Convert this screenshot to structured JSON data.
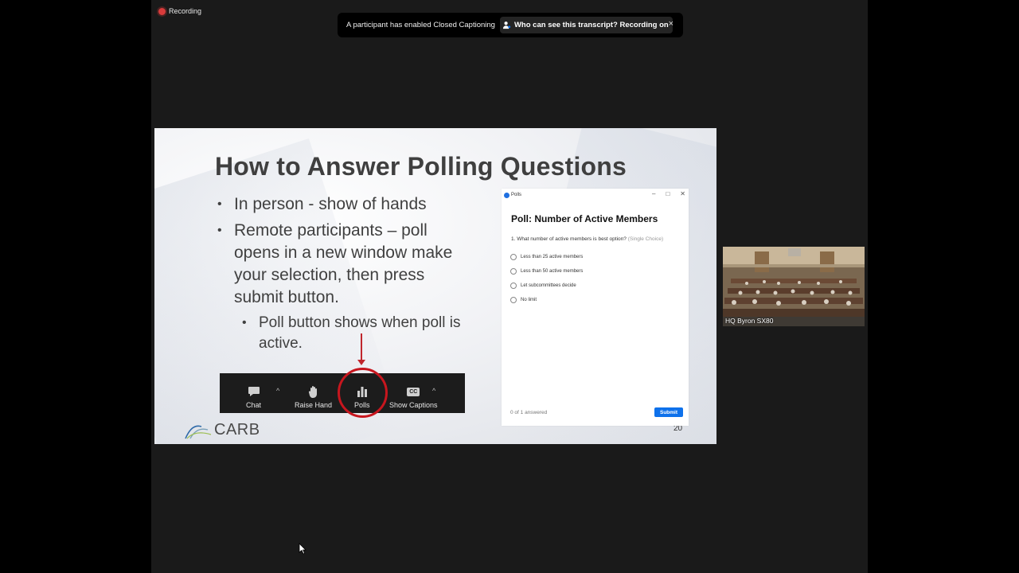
{
  "recording": {
    "label": "Recording"
  },
  "banner": {
    "message": "A participant has enabled Closed Captioning",
    "who_label": "Who can see this transcript? Recording on",
    "close_icon": "×"
  },
  "slide": {
    "title": "How to Answer Polling Questions",
    "bullets": [
      "In person - show of hands",
      "Remote participants – poll opens in a new window make your selection, then press submit button."
    ],
    "sub_bullet": "Poll button shows when poll is active.",
    "toolbar": {
      "chat": "Chat",
      "raise_hand": "Raise Hand",
      "polls": "Polls",
      "captions": "Show Captions",
      "captions_icon_text": "CC",
      "caret": "^"
    },
    "logo": "CARB",
    "page_number": "20"
  },
  "poll_window": {
    "app_name": "Polls",
    "title": "Poll: Number of Active Members",
    "question": "1. What number of active members is best option?",
    "question_hint": "(Single Choice)",
    "options": [
      "Less than 25 active members",
      "Less than 50 active members",
      "Let subcommittees decide",
      "No limit"
    ],
    "answered": "0 of 1 answered",
    "submit": "Submit"
  },
  "video_tile": {
    "name": "HQ Byron SX80"
  },
  "colors": {
    "accent": "#0e71eb",
    "highlight_ring": "#c7161e",
    "record": "#d93b3b"
  }
}
